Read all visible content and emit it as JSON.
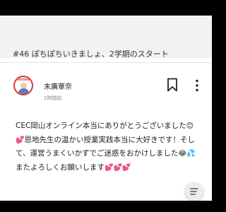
{
  "thread": {
    "title": "#46 ぽちぽちいきましょ、2学期のスタート"
  },
  "post": {
    "author": "末廣華奈",
    "avatar_text": "FUKUSHIMA",
    "timestamp": "2時間前",
    "body_segments": [
      "CEC岡山オンライン本当にありがとうございました",
      "😊💕",
      "恩地先生の温かい授業実践本当に大好きです！そして、運営うまくいかずでご迷惑をおかけしました",
      "😂💦",
      "またよろしくお願いします",
      "💕💕💕"
    ]
  },
  "icons": {
    "bookmark": "bookmark-icon",
    "more": "more-vertical-icon",
    "floating": "translate-icon"
  },
  "colors": {
    "header_bg": "#f2f2f4",
    "avatar_ring": "#d23b3b",
    "text": "#222222",
    "muted": "#888888"
  }
}
